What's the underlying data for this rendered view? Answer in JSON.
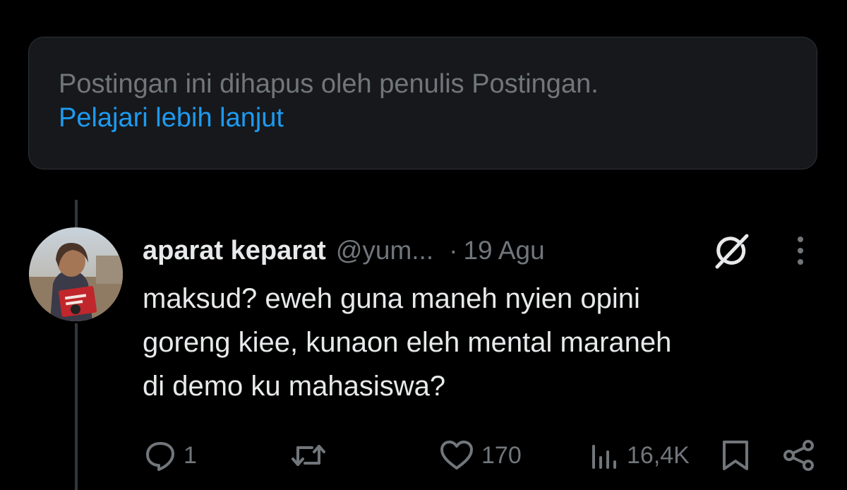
{
  "deleted_notice": {
    "message": "Postingan ini dihapus oleh penulis Postingan.",
    "link_label": "Pelajari lebih lanjut"
  },
  "reply": {
    "display_name": "aparat keparat",
    "handle": "@yum...",
    "separator": "·",
    "date": "19 Agu",
    "text": "maksud? eweh guna maneh nyien opini\ngoreng kiee, kunaon eleh mental maraneh\ndi demo ku mahasiswa?",
    "actions": {
      "replies": "1",
      "reposts": "",
      "likes": "170",
      "views": "16,4K"
    },
    "icons": {
      "avatar": "avatar-photo",
      "grok": "grok-icon",
      "more": "more-vertical-icon",
      "reply": "reply-icon",
      "repost": "repost-icon",
      "like": "heart-icon",
      "views": "views-bar-icon",
      "bookmark": "bookmark-icon",
      "share": "share-icon"
    }
  },
  "colors": {
    "background": "#000000",
    "card": "#16181c",
    "text_primary": "#e7e9ea",
    "text_secondary": "#71767b",
    "link": "#1d9bf0",
    "thread_line": "#333639"
  }
}
